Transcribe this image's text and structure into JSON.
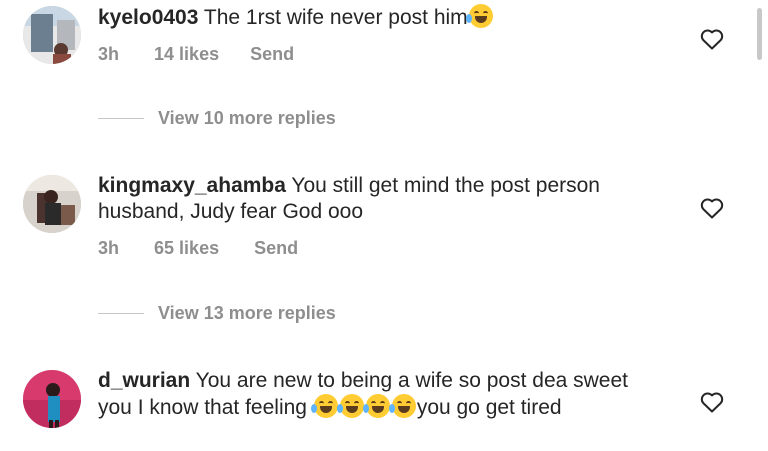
{
  "comments": [
    {
      "username": "kyelo0403",
      "text": "The 1rst wife never post him",
      "time": "3h",
      "likes": "14 likes",
      "send": "Send",
      "replies": "View 10 more replies"
    },
    {
      "username": "kingmaxy_ahamba",
      "text": "You still get mind the post person husband, Judy fear God ooo",
      "time": "3h",
      "likes": "65 likes",
      "send": "Send",
      "replies": "View 13 more replies"
    },
    {
      "username": "d_wurian",
      "text_part1": "You are new to being a wife so post dea sweet you I know that feeling ",
      "text_part2": "you go get tired"
    }
  ],
  "icons": {
    "like": "heart-outline-icon",
    "emoji": "face-with-tears-of-joy"
  },
  "colors": {
    "text": "#262626",
    "meta": "#8e8e8e"
  }
}
